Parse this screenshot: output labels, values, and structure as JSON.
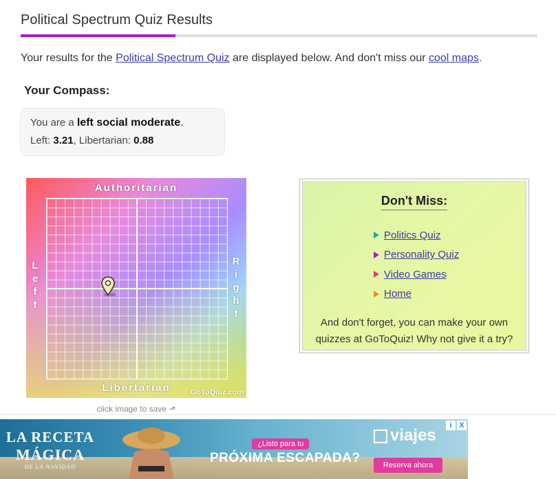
{
  "page": {
    "title": "Political Spectrum Quiz Results",
    "intro_prefix": "Your results for the ",
    "intro_link": "Political Spectrum Quiz",
    "intro_middle": " are displayed below. And don't miss our ",
    "intro_link2": "cool maps",
    "intro_suffix": "."
  },
  "compass": {
    "heading": "Your Compass:",
    "you_are_prefix": "You are a ",
    "result": "left social moderate",
    "you_are_suffix": ".",
    "left_label": "Left: ",
    "left_value": "3.21",
    "sep": ", ",
    "lib_label": "Libertarian: ",
    "lib_value": "0.88",
    "axis_top": "Authoritarian",
    "axis_bottom": "Libertarian",
    "axis_left": "Left",
    "axis_right": "Right",
    "watermark": "GoToQuiz.com",
    "pin_icon": "map-pin-icon",
    "caption": "click image to save ⬏"
  },
  "dont_miss": {
    "title": "Don't Miss:",
    "items": [
      {
        "label": "Politics Quiz",
        "color": "#2ba6a0"
      },
      {
        "label": "Personality Quiz",
        "color": "#a01fc4"
      },
      {
        "label": "Video Games",
        "color": "#e03a7a"
      },
      {
        "label": "Home",
        "color": "#f08a1e"
      }
    ],
    "footer": "And don't forget, you can make your own quizzes at GoToQuiz! Why not give it a try?"
  },
  "ad": {
    "brand_line1": "LA RECETA",
    "brand_line2": "MÁGICA",
    "brand_line3": "DE LA NAVIDAD",
    "tag": "¿Listo para tu",
    "headline": "PRÓXIMA ESCAPADA?",
    "logo": "viajes",
    "cta": "Reserva ahora",
    "info_icon": "i",
    "close_icon": "X"
  },
  "colors": {
    "accent": "#9b1de0",
    "link": "#3a3aa8"
  }
}
